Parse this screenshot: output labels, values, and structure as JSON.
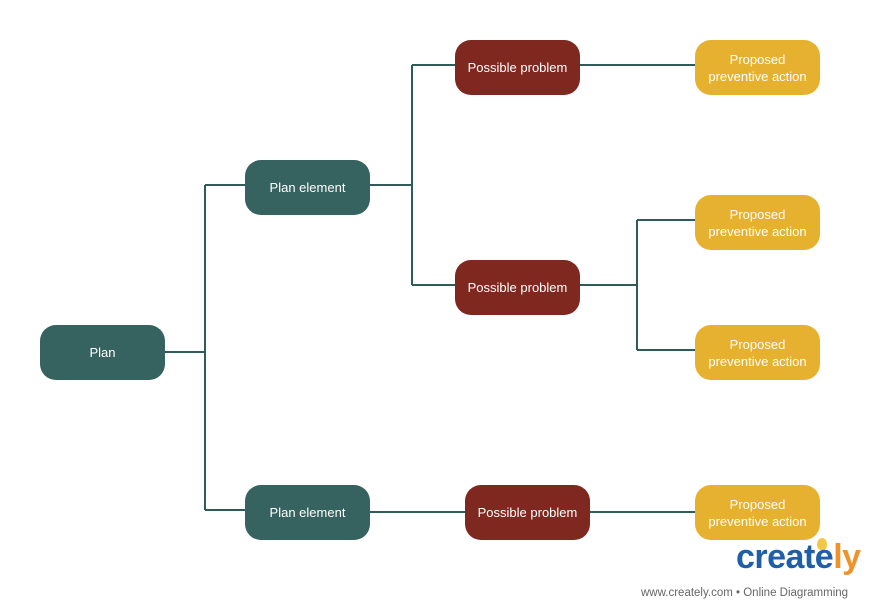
{
  "colors": {
    "plan": "#36625f",
    "problem": "#7f2820",
    "action": "#e6b12e",
    "connector": "#2f5b58"
  },
  "nodes": {
    "plan": "Plan",
    "plan_element_1": "Plan element",
    "plan_element_2": "Plan element",
    "problem_1": "Possible problem",
    "problem_2": "Possible problem",
    "problem_3": "Possible problem",
    "action_1": "Proposed preventive action",
    "action_2": "Proposed preventive action",
    "action_3": "Proposed preventive action",
    "action_4": "Proposed preventive action"
  },
  "branding": {
    "logo": "creately",
    "tagline": "www.creately.com • Online Diagramming"
  }
}
